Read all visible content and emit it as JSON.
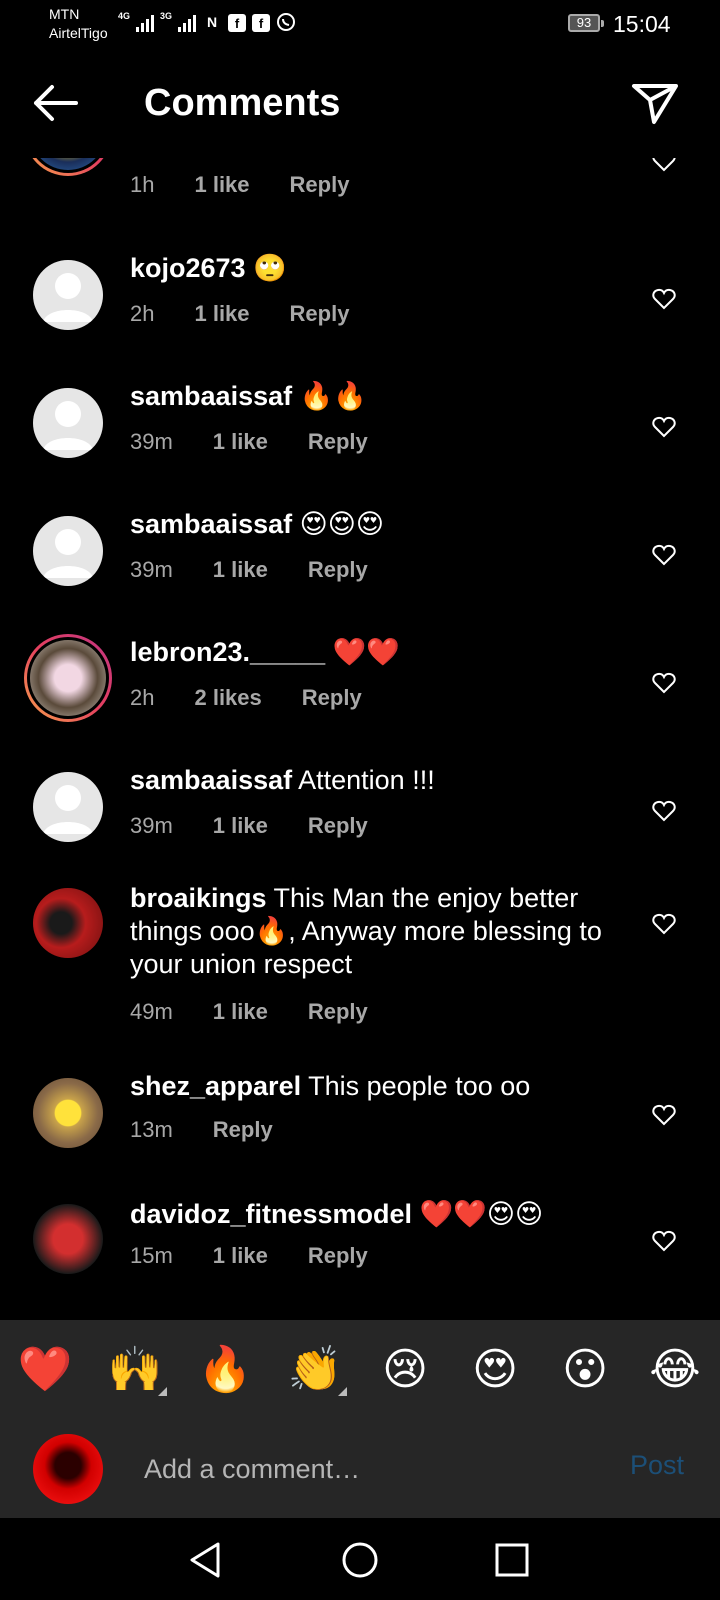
{
  "status_bar": {
    "carrier_1": "MTN",
    "carrier_2": "AirtelTigo",
    "network_1": "4G",
    "network_2": "3G",
    "battery": "93",
    "time": "15:04"
  },
  "header": {
    "title": "Comments"
  },
  "comments": [
    {
      "username": "",
      "text": "",
      "time": "1h",
      "likes": "1 like",
      "reply": "Reply"
    },
    {
      "username": "kojo2673",
      "text": " 🙄",
      "time": "2h",
      "likes": "1 like",
      "reply": "Reply"
    },
    {
      "username": "sambaaissaf",
      "text": " 🔥🔥",
      "time": "39m",
      "likes": "1 like",
      "reply": "Reply"
    },
    {
      "username": "sambaaissaf",
      "text": " 😍😍😍",
      "time": "39m",
      "likes": "1 like",
      "reply": "Reply"
    },
    {
      "username": "lebron23._____",
      "text": " ❤️❤️",
      "time": "2h",
      "likes": "2 likes",
      "reply": "Reply"
    },
    {
      "username": "sambaaissaf",
      "text": " Attention !!!",
      "time": "39m",
      "likes": "1 like",
      "reply": "Reply"
    },
    {
      "username": "broaikings",
      "text": " This Man the enjoy better things ooo🔥, Anyway more blessing to your union respect",
      "time": "49m",
      "likes": "1 like",
      "reply": "Reply"
    },
    {
      "username": "shez_apparel",
      "text": " This people too oo",
      "time": "13m",
      "likes": "",
      "reply": "Reply"
    },
    {
      "username": "davidoz_fitnessmodel",
      "text": " ❤️❤️😍😍",
      "time": "15m",
      "likes": "1 like",
      "reply": "Reply"
    }
  ],
  "emoji_bar": [
    "❤️",
    "🙌",
    "🔥",
    "👏",
    "😢",
    "😍",
    "😮",
    "😂"
  ],
  "composer": {
    "placeholder": "Add a comment…",
    "post_label": "Post"
  },
  "colors": {
    "background": "#000000",
    "panel": "#262626",
    "secondary_text": "#a8a8a8",
    "post_disabled": "#1c4f77"
  }
}
